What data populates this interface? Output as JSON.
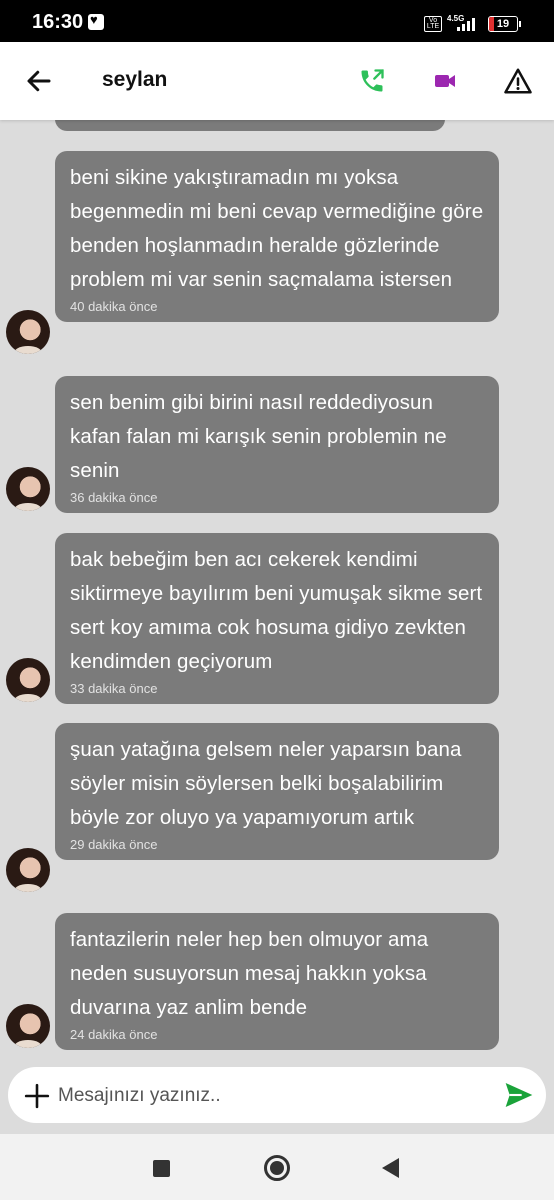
{
  "status_bar": {
    "time": "16:30",
    "network": "4.5G",
    "volte": "Vo LTE",
    "battery": "19",
    "battery_level": 0.19
  },
  "header": {
    "title": "seylan",
    "icons": [
      "back-arrow-icon",
      "phone-call-icon",
      "video-camera-icon",
      "warning-icon"
    ],
    "accent_call": "#2ec05a",
    "accent_video": "#9c27b0"
  },
  "messages": [
    {
      "text": "beni sikine yakıştıramadın mı yoksa begenmedin mi beni cevap vermediğine göre benden hoşlanmadın heralde gözlerinde problem mi var senin saçmalama istersen",
      "time": "40 dakika önce"
    },
    {
      "text": "sen benim gibi birini nasıl reddediyosun kafan falan mi karışık senin problemin ne senin",
      "time": "36 dakika önce"
    },
    {
      "text": "bak bebeğim ben acı cekerek kendimi siktirmeye bayılırım beni yumuşak sikme sert sert koy amıma cok hosuma gidiyo zevkten kendimden geçiyorum",
      "time": "33 dakika önce"
    },
    {
      "text": "şuan yatağına gelsem neler yaparsın bana söyler misin söylersen belki boşalabilirim böyle zor oluyo ya yapamıyorum artık",
      "time": "29 dakika önce"
    },
    {
      "text": "fantazilerin neler hep ben olmuyor ama neden susuyorsun mesaj hakkın yoksa duvarına yaz anlim bende",
      "time": "24 dakika önce"
    }
  ],
  "composer": {
    "placeholder": "Mesajınızı yazınız..",
    "send_color": "#1aa33a"
  },
  "nav": {
    "icons": [
      "recent-apps-icon",
      "home-icon",
      "nav-back-icon"
    ]
  }
}
